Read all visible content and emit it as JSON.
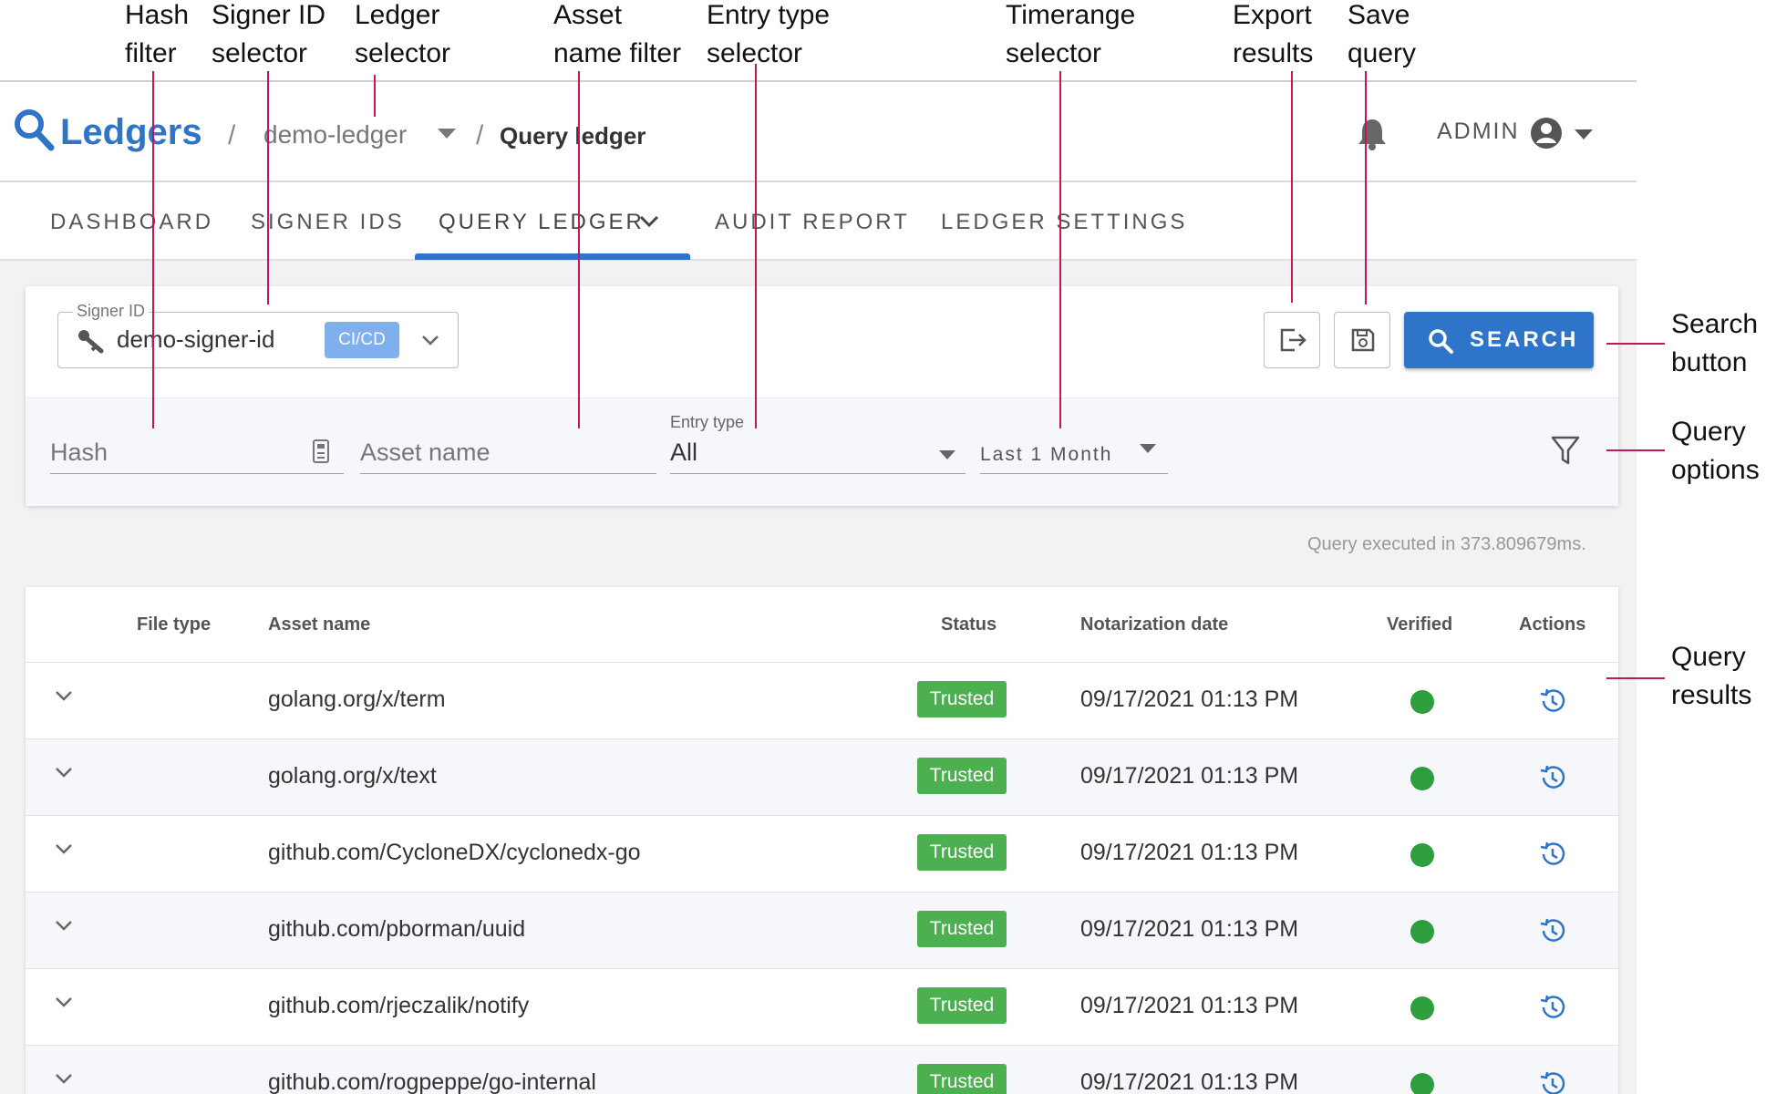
{
  "annotations": {
    "hash_filter": "Hash\nfilter",
    "signer_id_selector": "Signer ID\nselector",
    "ledger_selector": "Ledger\nselector",
    "asset_name_filter": "Asset\nname filter",
    "entry_type_selector": "Entry type\nselector",
    "timerange_selector": "Timerange\nselector",
    "export_results": "Export\nresults",
    "save_query": "Save\nquery",
    "search_button": "Search\nbutton",
    "query_options": "Query\noptions",
    "query_results": "Query\nresults"
  },
  "header": {
    "brand": "Ledgers",
    "separator": "/",
    "ledger": "demo-ledger",
    "page": "Query ledger",
    "user": "ADMIN"
  },
  "tabs": [
    {
      "label": "DASHBOARD"
    },
    {
      "label": "SIGNER IDS"
    },
    {
      "label": "QUERY LEDGER"
    },
    {
      "label": "AUDIT REPORT"
    },
    {
      "label": "LEDGER SETTINGS"
    }
  ],
  "query": {
    "signer_label": "Signer ID",
    "signer_value": "demo-signer-id",
    "signer_tag": "CI/CD",
    "search_label": "SEARCH",
    "hash_placeholder": "Hash",
    "asset_placeholder": "Asset name",
    "entry_type_label": "Entry type",
    "entry_type_value": "All",
    "timerange_value": "Last 1 Month"
  },
  "exec_time": "Query executed in 373.809679ms.",
  "table": {
    "headers": {
      "file_type": "File type",
      "asset_name": "Asset name",
      "status": "Status",
      "date": "Notarization date",
      "verified": "Verified",
      "actions": "Actions"
    },
    "rows": [
      {
        "name": "golang.org/x/term",
        "status": "Trusted",
        "date": "09/17/2021 01:13 PM"
      },
      {
        "name": "golang.org/x/text",
        "status": "Trusted",
        "date": "09/17/2021 01:13 PM"
      },
      {
        "name": "github.com/CycloneDX/cyclonedx-go",
        "status": "Trusted",
        "date": "09/17/2021 01:13 PM"
      },
      {
        "name": "github.com/pborman/uuid",
        "status": "Trusted",
        "date": "09/17/2021 01:13 PM"
      },
      {
        "name": "github.com/rjeczalik/notify",
        "status": "Trusted",
        "date": "09/17/2021 01:13 PM"
      },
      {
        "name": "github.com/rogpeppe/go-internal",
        "status": "Trusted",
        "date": "09/17/2021 01:13 PM"
      }
    ]
  },
  "colors": {
    "accent": "#2e74c8",
    "trusted": "#4caf50",
    "verified": "#2e9e3f",
    "annotation_line": "#c2185b"
  }
}
